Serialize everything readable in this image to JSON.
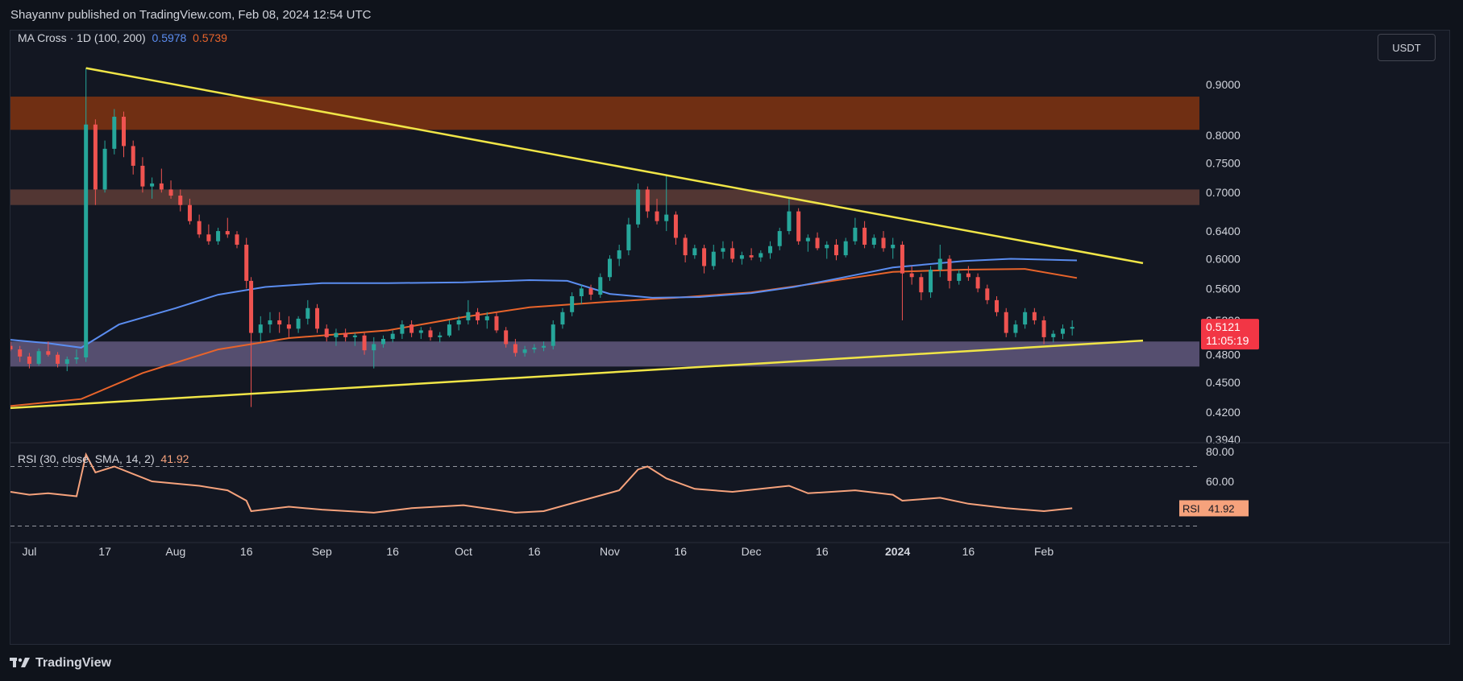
{
  "header": {
    "text": "Shayannv published on TradingView.com, Feb 08, 2024 12:54 UTC"
  },
  "legend": {
    "ma_label": "MA Cross · 1D (100, 200)",
    "ma100_value": "0.5978",
    "ma200_value": "0.5739",
    "rsi_label": "RSI (30, close, SMA, 14, 2)",
    "rsi_value": "41.92"
  },
  "currency_button": "USDT",
  "price_badge": {
    "price": "0.5121",
    "countdown": "11:05:19"
  },
  "rsi_badge": {
    "label": "RSI",
    "value": "41.92"
  },
  "footer": {
    "brand": "TradingView"
  },
  "colors": {
    "background": "#131722",
    "up": "#26a69a",
    "down": "#ef5350",
    "ma100": "#5b8df0",
    "ma200": "#e8642b",
    "trendline": "#f0e547",
    "rsi": "#f6a27c"
  },
  "chart_data": {
    "type": "candlestick",
    "y_scale": "log",
    "price_ticks": [
      "0.9000",
      "0.8000",
      "0.7500",
      "0.7000",
      "0.6400",
      "0.6000",
      "0.5600",
      "0.5200",
      "0.4800",
      "0.4500",
      "0.4200",
      "0.3940"
    ],
    "x_ticks": [
      "Jul",
      "17",
      "Aug",
      "16",
      "Sep",
      "16",
      "Oct",
      "16",
      "Nov",
      "16",
      "Dec",
      "16",
      "2024",
      "16",
      "Feb"
    ],
    "zones": [
      {
        "name": "supply-zone",
        "low": 0.81,
        "high": 0.875,
        "color": "#7b3212"
      },
      {
        "name": "resistance-zone",
        "low": 0.68,
        "high": 0.705,
        "color": "#5a3a35"
      },
      {
        "name": "support-zone",
        "low": 0.467,
        "high": 0.495,
        "color": "#5d5478"
      }
    ],
    "trendlines": [
      {
        "name": "descending-trendline",
        "from": [
          "2023-07-13",
          0.935
        ],
        "to": [
          "2024-02-22",
          0.594
        ]
      },
      {
        "name": "ascending-trendline",
        "from": [
          "2023-06-27",
          0.424
        ],
        "to": [
          "2024-02-22",
          0.496
        ]
      }
    ],
    "ma100_points": [
      [
        "2023-06-27",
        0.497
      ],
      [
        "2023-07-05",
        0.493
      ],
      [
        "2023-07-12",
        0.488
      ],
      [
        "2023-07-20",
        0.515
      ],
      [
        "2023-08-01",
        0.535
      ],
      [
        "2023-08-10",
        0.552
      ],
      [
        "2023-08-20",
        0.562
      ],
      [
        "2023-09-01",
        0.567
      ],
      [
        "2023-09-15",
        0.567
      ],
      [
        "2023-10-01",
        0.568
      ],
      [
        "2023-10-15",
        0.571
      ],
      [
        "2023-10-23",
        0.57
      ],
      [
        "2023-11-01",
        0.553
      ],
      [
        "2023-11-10",
        0.548
      ],
      [
        "2023-11-20",
        0.549
      ],
      [
        "2023-12-01",
        0.554
      ],
      [
        "2023-12-10",
        0.562
      ],
      [
        "2023-12-20",
        0.574
      ],
      [
        "2023-12-31",
        0.588
      ],
      [
        "2024-01-15",
        0.597
      ],
      [
        "2024-01-25",
        0.6
      ],
      [
        "2024-02-08",
        0.5978
      ]
    ],
    "ma200_points": [
      [
        "2023-06-27",
        0.426
      ],
      [
        "2023-07-12",
        0.433
      ],
      [
        "2023-07-25",
        0.46
      ],
      [
        "2023-08-10",
        0.486
      ],
      [
        "2023-08-25",
        0.499
      ],
      [
        "2023-09-15",
        0.508
      ],
      [
        "2023-10-01",
        0.524
      ],
      [
        "2023-10-15",
        0.536
      ],
      [
        "2023-11-01",
        0.543
      ],
      [
        "2023-11-15",
        0.548
      ],
      [
        "2023-12-01",
        0.555
      ],
      [
        "2023-12-15",
        0.567
      ],
      [
        "2023-12-31",
        0.582
      ],
      [
        "2024-01-15",
        0.585
      ],
      [
        "2024-01-28",
        0.586
      ],
      [
        "2024-02-08",
        0.5739
      ]
    ],
    "ohlc": [
      [
        "2023-06-27",
        0.49,
        0.495,
        0.484,
        0.486
      ],
      [
        "2023-06-29",
        0.486,
        0.49,
        0.472,
        0.478
      ],
      [
        "2023-07-01",
        0.478,
        0.482,
        0.465,
        0.47
      ],
      [
        "2023-07-03",
        0.47,
        0.487,
        0.468,
        0.484
      ],
      [
        "2023-07-05",
        0.484,
        0.495,
        0.478,
        0.48
      ],
      [
        "2023-07-07",
        0.48,
        0.483,
        0.466,
        0.47
      ],
      [
        "2023-07-09",
        0.47,
        0.478,
        0.462,
        0.475
      ],
      [
        "2023-07-11",
        0.475,
        0.486,
        0.47,
        0.477
      ],
      [
        "2023-07-13",
        0.477,
        0.935,
        0.472,
        0.82
      ],
      [
        "2023-07-15",
        0.82,
        0.83,
        0.68,
        0.705
      ],
      [
        "2023-07-17",
        0.705,
        0.79,
        0.7,
        0.775
      ],
      [
        "2023-07-19",
        0.775,
        0.85,
        0.765,
        0.835
      ],
      [
        "2023-07-21",
        0.835,
        0.845,
        0.76,
        0.78
      ],
      [
        "2023-07-23",
        0.78,
        0.79,
        0.73,
        0.745
      ],
      [
        "2023-07-25",
        0.745,
        0.76,
        0.7,
        0.71
      ],
      [
        "2023-07-27",
        0.71,
        0.725,
        0.69,
        0.715
      ],
      [
        "2023-07-29",
        0.715,
        0.74,
        0.7,
        0.705
      ],
      [
        "2023-07-31",
        0.705,
        0.72,
        0.69,
        0.695
      ],
      [
        "2023-08-02",
        0.695,
        0.705,
        0.67,
        0.68
      ],
      [
        "2023-08-04",
        0.68,
        0.69,
        0.65,
        0.655
      ],
      [
        "2023-08-06",
        0.655,
        0.665,
        0.63,
        0.635
      ],
      [
        "2023-08-08",
        0.635,
        0.65,
        0.62,
        0.625
      ],
      [
        "2023-08-10",
        0.625,
        0.645,
        0.62,
        0.64
      ],
      [
        "2023-08-12",
        0.64,
        0.66,
        0.63,
        0.635
      ],
      [
        "2023-08-14",
        0.635,
        0.64,
        0.615,
        0.62
      ],
      [
        "2023-08-16",
        0.62,
        0.63,
        0.56,
        0.57
      ],
      [
        "2023-08-17",
        0.57,
        0.575,
        0.425,
        0.505
      ],
      [
        "2023-08-19",
        0.505,
        0.525,
        0.495,
        0.515
      ],
      [
        "2023-08-21",
        0.515,
        0.53,
        0.505,
        0.52
      ],
      [
        "2023-08-23",
        0.52,
        0.53,
        0.505,
        0.515
      ],
      [
        "2023-08-25",
        0.515,
        0.525,
        0.5,
        0.51
      ],
      [
        "2023-08-27",
        0.51,
        0.525,
        0.505,
        0.522
      ],
      [
        "2023-08-29",
        0.522,
        0.545,
        0.515,
        0.535
      ],
      [
        "2023-08-31",
        0.535,
        0.54,
        0.505,
        0.51
      ],
      [
        "2023-09-02",
        0.51,
        0.515,
        0.495,
        0.5
      ],
      [
        "2023-09-04",
        0.5,
        0.51,
        0.49,
        0.505
      ],
      [
        "2023-09-06",
        0.505,
        0.51,
        0.495,
        0.5
      ],
      [
        "2023-09-08",
        0.5,
        0.505,
        0.49,
        0.502
      ],
      [
        "2023-09-10",
        0.502,
        0.505,
        0.48,
        0.485
      ],
      [
        "2023-09-12",
        0.485,
        0.5,
        0.465,
        0.492
      ],
      [
        "2023-09-14",
        0.492,
        0.502,
        0.488,
        0.498
      ],
      [
        "2023-09-16",
        0.498,
        0.508,
        0.494,
        0.504
      ],
      [
        "2023-09-18",
        0.504,
        0.52,
        0.498,
        0.515
      ],
      [
        "2023-09-20",
        0.515,
        0.52,
        0.5,
        0.505
      ],
      [
        "2023-09-22",
        0.505,
        0.512,
        0.498,
        0.508
      ],
      [
        "2023-09-24",
        0.508,
        0.512,
        0.496,
        0.5
      ],
      [
        "2023-09-26",
        0.5,
        0.506,
        0.494,
        0.502
      ],
      [
        "2023-09-28",
        0.502,
        0.52,
        0.5,
        0.515
      ],
      [
        "2023-09-30",
        0.515,
        0.525,
        0.508,
        0.52
      ],
      [
        "2023-10-02",
        0.52,
        0.545,
        0.515,
        0.53
      ],
      [
        "2023-10-04",
        0.53,
        0.535,
        0.515,
        0.52
      ],
      [
        "2023-10-06",
        0.52,
        0.53,
        0.51,
        0.525
      ],
      [
        "2023-10-08",
        0.525,
        0.53,
        0.505,
        0.508
      ],
      [
        "2023-10-10",
        0.508,
        0.512,
        0.488,
        0.492
      ],
      [
        "2023-10-12",
        0.492,
        0.498,
        0.478,
        0.482
      ],
      [
        "2023-10-14",
        0.482,
        0.49,
        0.478,
        0.486
      ],
      [
        "2023-10-16",
        0.486,
        0.492,
        0.482,
        0.488
      ],
      [
        "2023-10-18",
        0.488,
        0.495,
        0.484,
        0.49
      ],
      [
        "2023-10-20",
        0.49,
        0.52,
        0.486,
        0.515
      ],
      [
        "2023-10-22",
        0.515,
        0.535,
        0.51,
        0.53
      ],
      [
        "2023-10-24",
        0.53,
        0.555,
        0.525,
        0.55
      ],
      [
        "2023-10-26",
        0.55,
        0.565,
        0.54,
        0.56
      ],
      [
        "2023-10-28",
        0.56,
        0.565,
        0.545,
        0.552
      ],
      [
        "2023-10-30",
        0.552,
        0.58,
        0.548,
        0.575
      ],
      [
        "2023-11-01",
        0.575,
        0.605,
        0.57,
        0.6
      ],
      [
        "2023-11-03",
        0.6,
        0.62,
        0.59,
        0.612
      ],
      [
        "2023-11-05",
        0.612,
        0.66,
        0.605,
        0.65
      ],
      [
        "2023-11-07",
        0.65,
        0.715,
        0.645,
        0.705
      ],
      [
        "2023-11-09",
        0.705,
        0.71,
        0.66,
        0.67
      ],
      [
        "2023-11-11",
        0.67,
        0.69,
        0.65,
        0.655
      ],
      [
        "2023-11-13",
        0.655,
        0.73,
        0.64,
        0.665
      ],
      [
        "2023-11-15",
        0.665,
        0.67,
        0.62,
        0.63
      ],
      [
        "2023-11-17",
        0.63,
        0.635,
        0.595,
        0.605
      ],
      [
        "2023-11-19",
        0.605,
        0.62,
        0.6,
        0.615
      ],
      [
        "2023-11-21",
        0.615,
        0.62,
        0.58,
        0.59
      ],
      [
        "2023-11-23",
        0.59,
        0.62,
        0.585,
        0.61
      ],
      [
        "2023-11-25",
        0.61,
        0.625,
        0.6,
        0.615
      ],
      [
        "2023-11-27",
        0.615,
        0.625,
        0.595,
        0.6
      ],
      [
        "2023-11-29",
        0.6,
        0.61,
        0.592,
        0.605
      ],
      [
        "2023-12-01",
        0.605,
        0.615,
        0.598,
        0.602
      ],
      [
        "2023-12-03",
        0.602,
        0.612,
        0.596,
        0.608
      ],
      [
        "2023-12-05",
        0.608,
        0.625,
        0.6,
        0.618
      ],
      [
        "2023-12-07",
        0.618,
        0.645,
        0.612,
        0.64
      ],
      [
        "2023-12-09",
        0.64,
        0.69,
        0.635,
        0.67
      ],
      [
        "2023-12-11",
        0.67,
        0.675,
        0.62,
        0.625
      ],
      [
        "2023-12-13",
        0.625,
        0.635,
        0.61,
        0.63
      ],
      [
        "2023-12-15",
        0.63,
        0.638,
        0.612,
        0.615
      ],
      [
        "2023-12-17",
        0.615,
        0.625,
        0.6,
        0.62
      ],
      [
        "2023-12-19",
        0.62,
        0.628,
        0.598,
        0.605
      ],
      [
        "2023-12-21",
        0.605,
        0.63,
        0.602,
        0.625
      ],
      [
        "2023-12-23",
        0.625,
        0.66,
        0.62,
        0.645
      ],
      [
        "2023-12-25",
        0.645,
        0.655,
        0.615,
        0.62
      ],
      [
        "2023-12-27",
        0.62,
        0.635,
        0.615,
        0.63
      ],
      [
        "2023-12-29",
        0.63,
        0.64,
        0.61,
        0.615
      ],
      [
        "2023-12-31",
        0.615,
        0.63,
        0.6,
        0.62
      ],
      [
        "2024-01-02",
        0.62,
        0.625,
        0.52,
        0.58
      ],
      [
        "2024-01-04",
        0.58,
        0.59,
        0.565,
        0.575
      ],
      [
        "2024-01-06",
        0.575,
        0.58,
        0.545,
        0.555
      ],
      [
        "2024-01-08",
        0.555,
        0.59,
        0.548,
        0.585
      ],
      [
        "2024-01-10",
        0.585,
        0.62,
        0.575,
        0.6
      ],
      [
        "2024-01-12",
        0.6,
        0.605,
        0.56,
        0.57
      ],
      [
        "2024-01-14",
        0.57,
        0.585,
        0.565,
        0.58
      ],
      [
        "2024-01-16",
        0.58,
        0.59,
        0.57,
        0.575
      ],
      [
        "2024-01-18",
        0.575,
        0.58,
        0.555,
        0.56
      ],
      [
        "2024-01-20",
        0.56,
        0.565,
        0.54,
        0.545
      ],
      [
        "2024-01-22",
        0.545,
        0.55,
        0.525,
        0.53
      ],
      [
        "2024-01-24",
        0.53,
        0.535,
        0.5,
        0.505
      ],
      [
        "2024-01-26",
        0.505,
        0.52,
        0.5,
        0.515
      ],
      [
        "2024-01-28",
        0.515,
        0.535,
        0.51,
        0.53
      ],
      [
        "2024-01-30",
        0.53,
        0.535,
        0.515,
        0.52
      ],
      [
        "2024-02-01",
        0.52,
        0.525,
        0.492,
        0.5
      ],
      [
        "2024-02-03",
        0.5,
        0.508,
        0.494,
        0.504
      ],
      [
        "2024-02-05",
        0.504,
        0.515,
        0.498,
        0.51
      ],
      [
        "2024-02-07",
        0.51,
        0.52,
        0.502,
        0.5121
      ]
    ],
    "rsi": {
      "ticks": [
        "80.00",
        "60.00"
      ],
      "upper_band": 70,
      "lower_band": 30,
      "points": [
        [
          "2023-06-27",
          53
        ],
        [
          "2023-07-01",
          51
        ],
        [
          "2023-07-05",
          52
        ],
        [
          "2023-07-11",
          50
        ],
        [
          "2023-07-13",
          78
        ],
        [
          "2023-07-15",
          66
        ],
        [
          "2023-07-19",
          70
        ],
        [
          "2023-07-23",
          65
        ],
        [
          "2023-07-27",
          60
        ],
        [
          "2023-08-06",
          57
        ],
        [
          "2023-08-12",
          54
        ],
        [
          "2023-08-16",
          47
        ],
        [
          "2023-08-17",
          40
        ],
        [
          "2023-08-25",
          43
        ],
        [
          "2023-09-01",
          41
        ],
        [
          "2023-09-12",
          39
        ],
        [
          "2023-09-20",
          42
        ],
        [
          "2023-10-01",
          44
        ],
        [
          "2023-10-12",
          39
        ],
        [
          "2023-10-18",
          40
        ],
        [
          "2023-10-26",
          47
        ],
        [
          "2023-11-03",
          54
        ],
        [
          "2023-11-07",
          68
        ],
        [
          "2023-11-09",
          70
        ],
        [
          "2023-11-13",
          62
        ],
        [
          "2023-11-19",
          55
        ],
        [
          "2023-11-27",
          53
        ],
        [
          "2023-12-09",
          57
        ],
        [
          "2023-12-13",
          52
        ],
        [
          "2023-12-23",
          54
        ],
        [
          "2023-12-31",
          51
        ],
        [
          "2024-01-02",
          47
        ],
        [
          "2024-01-10",
          49
        ],
        [
          "2024-01-16",
          45
        ],
        [
          "2024-01-24",
          42
        ],
        [
          "2024-02-01",
          40
        ],
        [
          "2024-02-07",
          41.92
        ]
      ]
    }
  }
}
